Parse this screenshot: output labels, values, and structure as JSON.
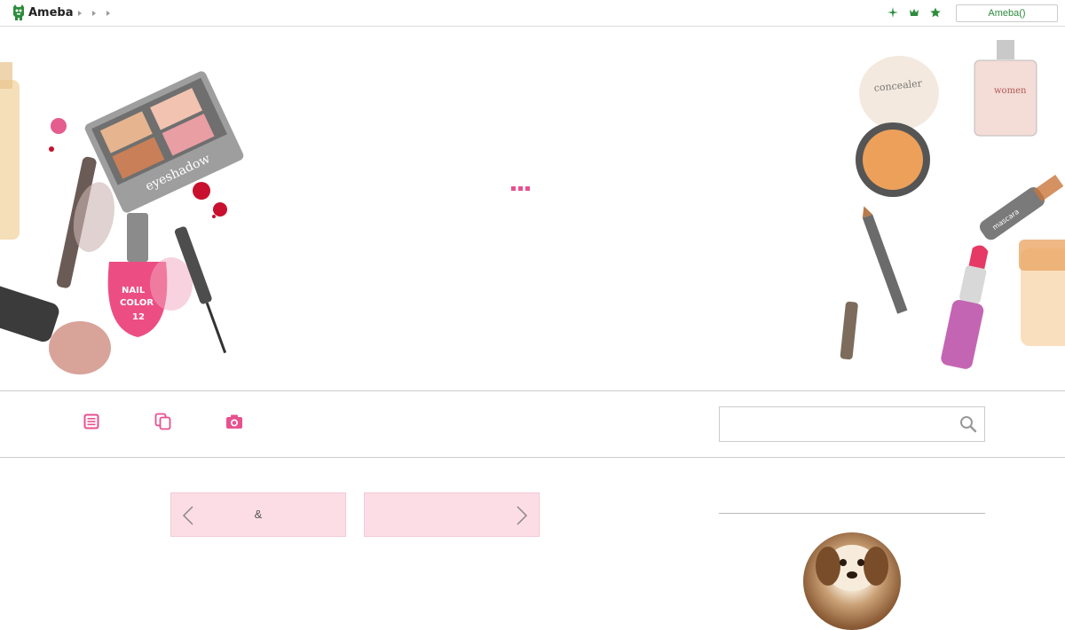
{
  "topbar": {
    "logo_text": "Ameba",
    "account_button": "Ameba()",
    "icons": [
      "sparkle-icon",
      "crown-icon",
      "star-icon"
    ],
    "accent": "#2d8c3c"
  },
  "hero": {
    "loading_indicator": "...",
    "accent": "#e8508f"
  },
  "nav": {
    "icons": [
      "blog-entries-icon",
      "copy-icon",
      "camera-icon"
    ],
    "search_placeholder": "",
    "accent": "#e8508f"
  },
  "pager": {
    "prev_label": "&",
    "next_label": "",
    "background": "#fcdde6"
  }
}
